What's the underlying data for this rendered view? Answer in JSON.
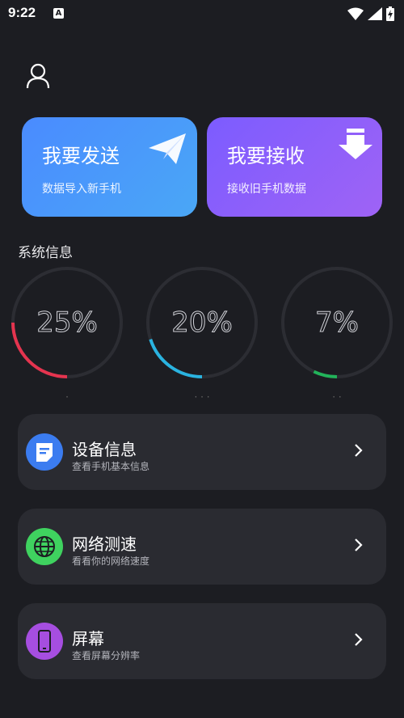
{
  "status": {
    "time": "9:22",
    "notif_letter": "A"
  },
  "cards": {
    "send": {
      "title": "我要发送",
      "subtitle": "数据导入新手机"
    },
    "receive": {
      "title": "我要接收",
      "subtitle": "接收旧手机数据"
    }
  },
  "system": {
    "title": "系统信息",
    "gauges": [
      {
        "value_text": "25%",
        "percent": 25,
        "color": "#e5344f",
        "label": "·"
      },
      {
        "value_text": "20%",
        "percent": 20,
        "color": "#2ab3e0",
        "label": "· · ·"
      },
      {
        "value_text": "7%",
        "percent": 7,
        "color": "#22b35a",
        "label": "· ·"
      }
    ]
  },
  "menu": [
    {
      "title": "设备信息",
      "subtitle": "查看手机基本信息",
      "icon": "document-icon",
      "color": "#3b7cf0"
    },
    {
      "title": "网络测速",
      "subtitle": "看看你的网络速度",
      "icon": "globe-icon",
      "color": "#3fd25f"
    },
    {
      "title": "屏幕",
      "subtitle": "查看屏幕分辨率",
      "icon": "phone-icon",
      "color": "#a64ee0"
    }
  ]
}
